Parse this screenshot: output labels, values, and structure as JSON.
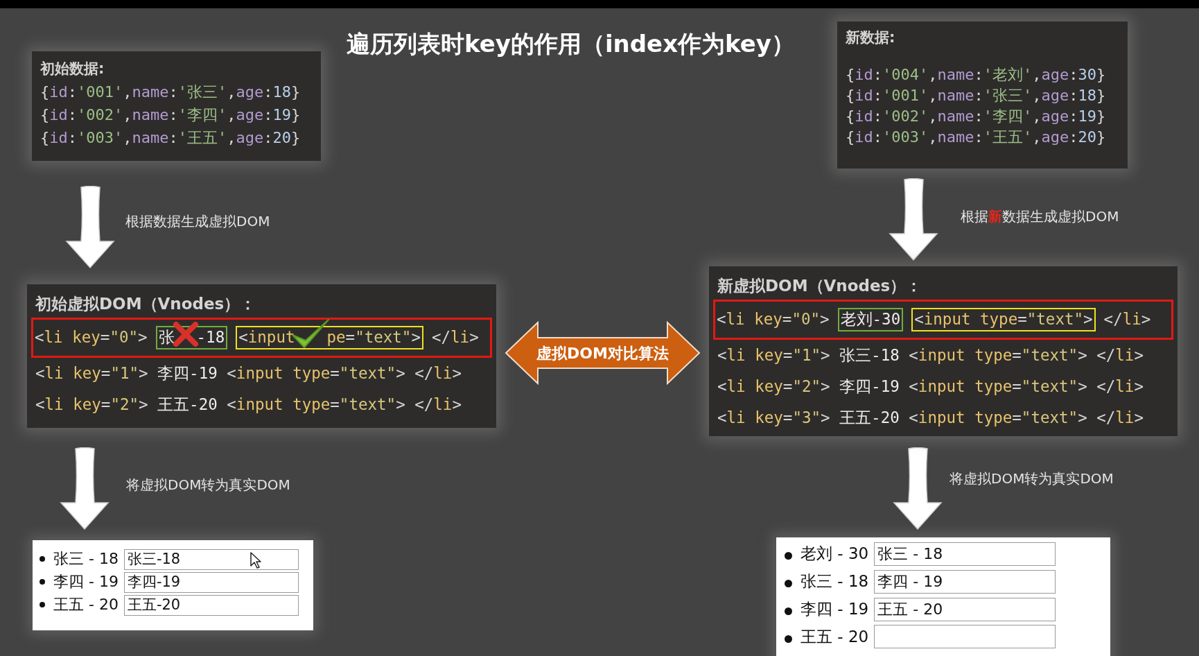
{
  "title": "遍历列表时key的作用（index作为key）",
  "initial_data": {
    "title": "初始数据:",
    "lines": [
      "{id:'001',name:'张三',age:18}",
      "{id:'002',name:'李四',age:19}",
      "{id:'003',name:'王五',age:20}"
    ]
  },
  "to_vdom_label": "根据数据生成虚拟DOM",
  "initial_vdom": {
    "title": "初始虚拟DOM（Vnodes）：",
    "rows": [
      {
        "highlighted": true,
        "open": "<li key=\"0\">",
        "name": {
          "before": "张",
          "kind": "cross",
          "after": "-18"
        },
        "input": {
          "before": "<input",
          "kind": "check",
          "after": "pe=\"text\">"
        },
        "close": "</li>"
      },
      {
        "highlighted": false,
        "open": "<li key=\"1\">",
        "name": {
          "text": "李四-19"
        },
        "input": {
          "text": "<input type=\"text\">"
        },
        "close": "</li>"
      },
      {
        "highlighted": false,
        "open": "<li key=\"2\">",
        "name": {
          "text": "王五-20"
        },
        "input": {
          "text": "<input type=\"text\">"
        },
        "close": "</li>"
      }
    ]
  },
  "diff_label": "虚拟DOM对比算法",
  "to_real_dom_label": "将虚拟DOM转为真实DOM",
  "initial_real_dom": {
    "items": [
      {
        "label": "张三 - 18",
        "value": "张三-18",
        "cursor": true
      },
      {
        "label": "李四 - 19",
        "value": "李四-19",
        "cursor": false
      },
      {
        "label": "王五 - 20",
        "value": "王五-20",
        "cursor": false
      }
    ]
  },
  "new_data": {
    "title": "新数据:",
    "lines": [
      "{id:'004',name:'老刘',age:30}",
      "{id:'001',name:'张三',age:18}",
      "{id:'002',name:'李四',age:19}",
      "{id:'003',name:'王五',age:20}"
    ]
  },
  "new_to_vdom_label": "根据**新**数据生成虚拟DOM",
  "new_vdom": {
    "title": "新虚拟DOM（Vnodes）：",
    "rows": [
      {
        "highlighted": true,
        "open": "<li key=\"0\">",
        "name": {
          "text": "老刘-30"
        },
        "input": {
          "text": "<input type=\"text\">"
        },
        "close": "</li>"
      },
      {
        "highlighted": false,
        "open": "<li key=\"1\">",
        "name": {
          "text": "张三-18"
        },
        "input": {
          "text": "<input type=\"text\">"
        },
        "close": "</li>"
      },
      {
        "highlighted": false,
        "open": "<li key=\"2\">",
        "name": {
          "text": "李四-19"
        },
        "input": {
          "text": "<input type=\"text\">"
        },
        "close": "</li>"
      },
      {
        "highlighted": false,
        "open": "<li key=\"3\">",
        "name": {
          "text": "王五-20"
        },
        "input": {
          "text": "<input type=\"text\">"
        },
        "close": "</li>"
      }
    ]
  },
  "new_to_real_dom_label": "将虚拟DOM转为真实DOM",
  "new_real_dom": {
    "items": [
      {
        "label": "老刘 - 30",
        "value": "张三 - 18",
        "cursor": false
      },
      {
        "label": "张三 - 18",
        "value": "李四 - 19",
        "cursor": false
      },
      {
        "label": "李四 - 19",
        "value": "王五 - 20",
        "cursor": false
      },
      {
        "label": "王五 - 20",
        "cursor": false
      }
    ]
  }
}
